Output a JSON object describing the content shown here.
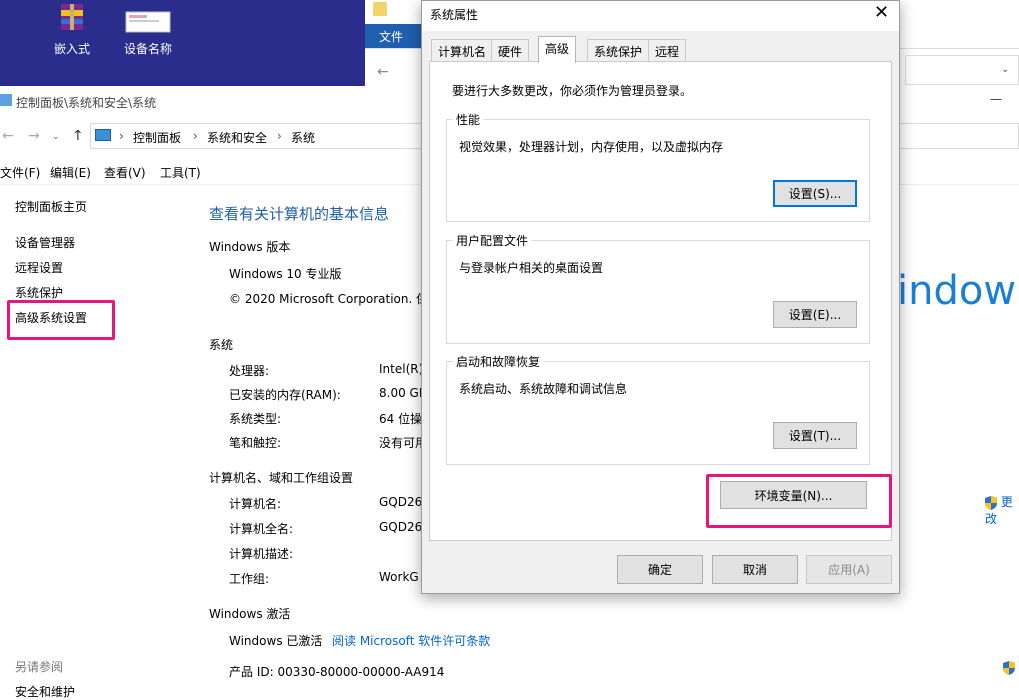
{
  "desktop": {
    "icons": [
      {
        "label": "嵌入式",
        "icon": "winrar-archive-icon"
      },
      {
        "label": "设备名称",
        "icon": "image-file-icon"
      }
    ]
  },
  "explorer_bg": {
    "ribbon_tab": "文件"
  },
  "control_panel": {
    "title_path": "控制面板\\系统和安全\\系统",
    "breadcrumb": [
      "控制面板",
      "系统和安全",
      "系统"
    ],
    "menu": [
      "文件(F)",
      "编辑(E)",
      "查看(V)",
      "工具(T)"
    ],
    "sidebar": {
      "home": "控制面板主页",
      "items": [
        "设备管理器",
        "远程设置",
        "系统保护",
        "高级系统设置"
      ],
      "see_also": "另请参阅",
      "see_also_item": "安全和维护"
    },
    "heading": "查看有关计算机的基本信息",
    "windows_edition": {
      "title": "Windows 版本",
      "edition": "Windows 10 专业版",
      "copyright": "© 2020 Microsoft Corporation. 保"
    },
    "logo_text": "indow",
    "system": {
      "title": "系统",
      "rows": [
        {
          "label": "处理器:",
          "value": "Intel(R)"
        },
        {
          "label": "已安装的内存(RAM):",
          "value": "8.00 GE"
        },
        {
          "label": "系统类型:",
          "value": "64 位操"
        },
        {
          "label": "笔和触控:",
          "value": "没有可用"
        }
      ]
    },
    "computer_name": {
      "title": "计算机名、域和工作组设置",
      "rows": [
        {
          "label": "计算机名:",
          "value": "GQD26"
        },
        {
          "label": "计算机全名:",
          "value": "GQD26"
        },
        {
          "label": "计算机描述:",
          "value": ""
        },
        {
          "label": "工作组:",
          "value": "WorkG"
        }
      ],
      "change_link": "更改"
    },
    "activation": {
      "title": "Windows 激活",
      "status": "Windows 已激活",
      "license_link": "阅读 Microsoft 软件许可条款",
      "product_id": "产品 ID: 00330-80000-00000-AA914"
    }
  },
  "dialog": {
    "title": "系统属性",
    "tabs": [
      "计算机名",
      "硬件",
      "高级",
      "系统保护",
      "远程"
    ],
    "active_tab": "高级",
    "admin_note": "要进行大多数更改，你必须作为管理员登录。",
    "performance": {
      "title": "性能",
      "desc": "视觉效果，处理器计划，内存使用，以及虚拟内存",
      "button": "设置(S)..."
    },
    "user_profile": {
      "title": "用户配置文件",
      "desc": "与登录帐户相关的桌面设置",
      "button": "设置(E)..."
    },
    "startup": {
      "title": "启动和故障恢复",
      "desc": "系统启动、系统故障和调试信息",
      "button": "设置(T)..."
    },
    "env_button": "环境变量(N)...",
    "ok": "确定",
    "cancel": "取消",
    "apply": "应用(A)"
  },
  "colors": {
    "highlight": "#e6167c",
    "link": "#0066cc",
    "heading": "#1f5fa8",
    "desktop": "#2a2d8c"
  }
}
